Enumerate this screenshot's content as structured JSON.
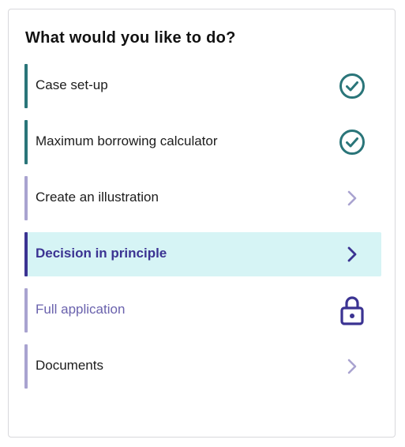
{
  "panel": {
    "title": "What would you like to do?"
  },
  "items": [
    {
      "label": "Case set-up",
      "status": "complete",
      "icon": "check-circle-icon"
    },
    {
      "label": "Maximum borrowing calculator",
      "status": "complete",
      "icon": "check-circle-icon"
    },
    {
      "label": "Create an illustration",
      "status": "available",
      "icon": "chevron-right-icon"
    },
    {
      "label": "Decision in principle",
      "status": "selected",
      "icon": "chevron-right-icon"
    },
    {
      "label": "Full application",
      "status": "locked",
      "icon": "lock-icon"
    },
    {
      "label": "Documents",
      "status": "available",
      "icon": "chevron-right-icon"
    }
  ],
  "colors": {
    "complete": "#2a7579",
    "accent": "#3b3392",
    "muted": "#a9a3d0",
    "selected_bg": "#d6f4f5"
  }
}
